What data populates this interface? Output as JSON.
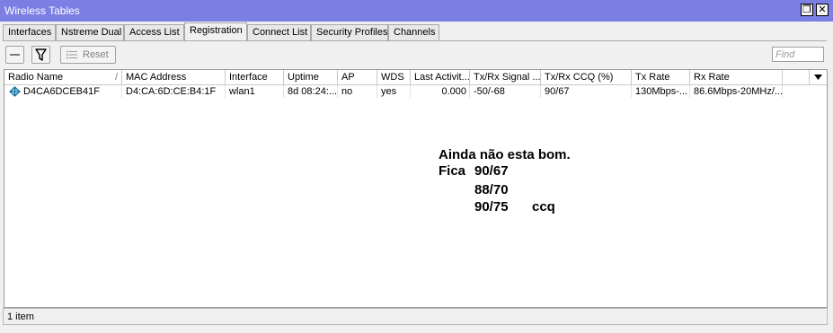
{
  "window": {
    "title": "Wireless Tables",
    "restore_glyph": "❐",
    "close_glyph": "✕"
  },
  "tabs": [
    {
      "label": "Interfaces"
    },
    {
      "label": "Nstreme Dual"
    },
    {
      "label": "Access List"
    },
    {
      "label": "Registration"
    },
    {
      "label": "Connect List"
    },
    {
      "label": "Security Profiles"
    },
    {
      "label": "Channels"
    }
  ],
  "toolbar": {
    "reset_label": "Reset",
    "find_placeholder": "Find"
  },
  "table": {
    "columns": [
      "Radio Name",
      "MAC Address",
      "Interface",
      "Uptime",
      "AP",
      "WDS",
      "Last Activit...",
      "Tx/Rx Signal ...",
      "Tx/Rx CCQ (%)",
      "Tx Rate",
      "Rx Rate"
    ],
    "sort_indicator": "/",
    "rows": [
      {
        "radio_name": "D4CA6DCEB41F",
        "mac": "D4:CA:6D:CE:B4:1F",
        "interface": "wlan1",
        "uptime": "8d 08:24:...",
        "ap": "no",
        "wds": "yes",
        "last_activity": "0.000",
        "signal": "-50/-68",
        "ccq": "90/67",
        "tx_rate": "130Mbps-...",
        "rx_rate": "86.6Mbps-20MHz/..."
      }
    ]
  },
  "annotation": {
    "line1": "Ainda não esta bom.",
    "fica": "Fica",
    "v1": "90/67",
    "v2": "88/70",
    "v3": "90/75",
    "ccq": "ccq"
  },
  "status": {
    "count": "1 item"
  }
}
